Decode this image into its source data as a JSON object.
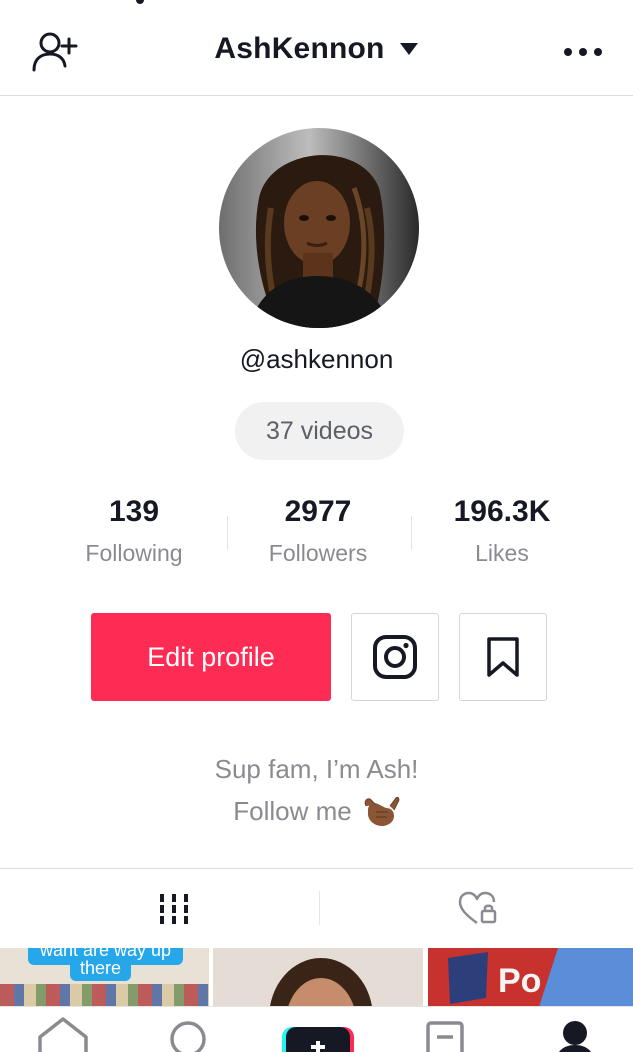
{
  "header": {
    "username": "AshKennon"
  },
  "profile": {
    "handle": "@ashkennon",
    "videos_label": "37 videos"
  },
  "stats": [
    {
      "value": "139",
      "label": "Following"
    },
    {
      "value": "2977",
      "label": "Followers"
    },
    {
      "value": "196.3K",
      "label": "Likes"
    }
  ],
  "actions": {
    "edit_label": "Edit profile"
  },
  "bio": {
    "line1": "Sup fam, I’m Ash!",
    "line2": "Follow me",
    "emoji": "🤙🏾"
  },
  "tabs": {
    "active": "videos-grid",
    "items": [
      "videos-grid-icon",
      "liked-private-icon"
    ]
  },
  "grid": {
    "thumb1_caption_top": "want are way up",
    "thumb1_caption": "there"
  },
  "colors": {
    "accent": "#fe2c55",
    "text": "#161823",
    "muted": "#8a8b91",
    "caption_bg": "#25a7e9"
  },
  "icons": {
    "header_left": "add-user-icon",
    "header_caret": "caret-down-icon",
    "header_right": "more-icon",
    "instagram": "instagram-icon",
    "bookmark": "bookmark-icon",
    "nav": [
      "home-icon",
      "discover-icon",
      "create-icon",
      "inbox-icon",
      "profile-icon"
    ]
  }
}
